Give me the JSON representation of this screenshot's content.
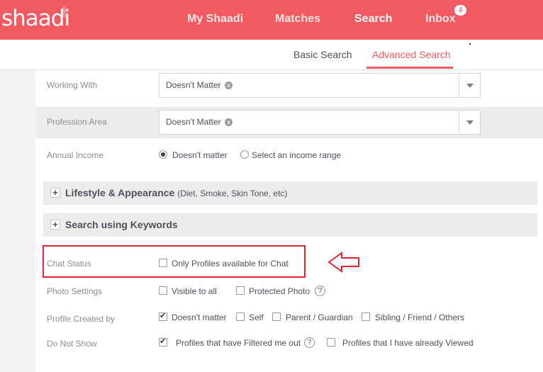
{
  "topnav": {
    "logo": "shaadi",
    "logo_suffix": ".com",
    "items": [
      {
        "label": "My Shaadi"
      },
      {
        "label": "Matches"
      },
      {
        "label": "Search"
      },
      {
        "label": "Inbox"
      }
    ],
    "inbox_badge": "4"
  },
  "subnav": {
    "items": [
      {
        "label": "Basic Search"
      },
      {
        "label": "Advanced Search"
      }
    ]
  },
  "form": {
    "working_with": {
      "label": "Working With",
      "value": "Doesn't Matter"
    },
    "profession_area": {
      "label": "Profession Area",
      "value": "Doesn't Matter"
    },
    "annual_income": {
      "label": "Annual Income",
      "options": [
        "Doesn't matter",
        "Select an income range"
      ]
    },
    "lifestyle": {
      "title": "Lifestyle & Appearance",
      "subtitle": "(Diet, Smoke, Skin Tone, etc)"
    },
    "keywords": {
      "title": "Search using Keywords"
    },
    "chat_status": {
      "label": "Chat Status",
      "option": "Only Profiles available for Chat"
    },
    "photo_settings": {
      "label": "Photo Settings",
      "options": [
        "Visible to all",
        "Protected Photo"
      ]
    },
    "profile_created_by": {
      "label": "Profile Created by",
      "options": [
        "Doesn't matter",
        "Self",
        "Parent / Guardian",
        "Sibling / Friend / Others"
      ]
    },
    "do_not_show": {
      "label": "Do Not Show",
      "options": [
        "Profiles that have Filtered me out",
        "Profiles that I have already Viewed"
      ]
    }
  },
  "icons": {
    "help": "?",
    "plus": "+",
    "clear": "x"
  },
  "colors": {
    "brand": "#f05a60",
    "highlight": "#e0272f"
  }
}
